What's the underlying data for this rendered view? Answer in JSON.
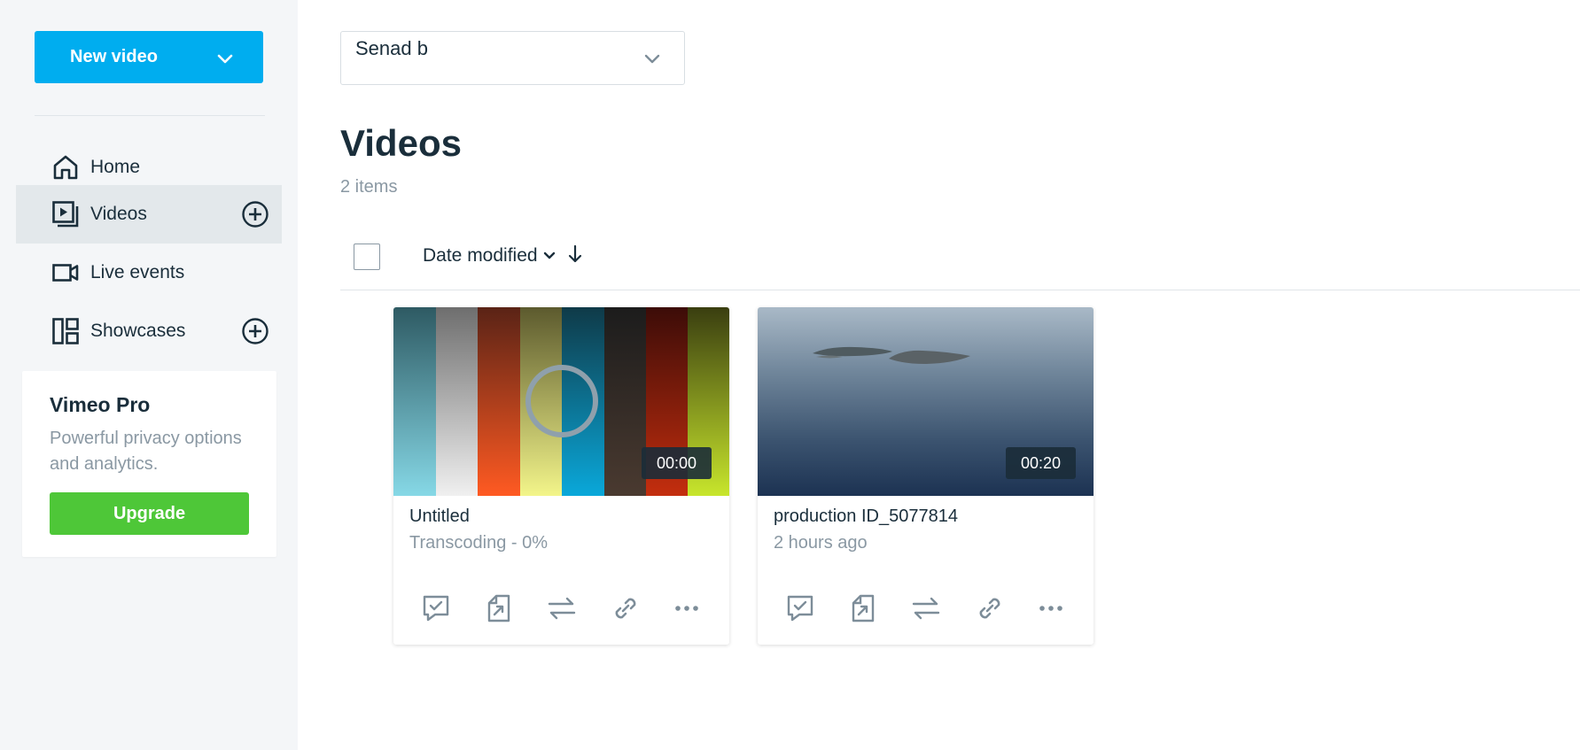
{
  "sidebar": {
    "new_video_label": "New video",
    "items": [
      {
        "label": "Home"
      },
      {
        "label": "Videos"
      },
      {
        "label": "Live events"
      },
      {
        "label": "Showcases"
      }
    ],
    "pro_card": {
      "title": "Vimeo Pro",
      "description": "Powerful privacy options and analytics.",
      "upgrade_label": "Upgrade"
    }
  },
  "main": {
    "account_select_value": "Senad b",
    "title": "Videos",
    "item_count": "2 items",
    "sort_label": "Date modified",
    "videos": [
      {
        "title": "Untitled",
        "subtitle": "Transcoding - 0%",
        "duration": "00:00"
      },
      {
        "title": "production ID_5077814",
        "subtitle": "2 hours ago",
        "duration": "00:20"
      }
    ]
  },
  "colors": {
    "accent": "#00adef",
    "upgrade": "#4ec738",
    "muted_text": "#8a98a3",
    "primary_text": "#1a2e3b"
  },
  "icons": {
    "nav": [
      "home-icon",
      "videos-icon",
      "live-events-icon",
      "showcases-icon"
    ],
    "card_actions": [
      "review-icon",
      "share-icon",
      "replace-icon",
      "link-icon",
      "more-icon"
    ]
  }
}
